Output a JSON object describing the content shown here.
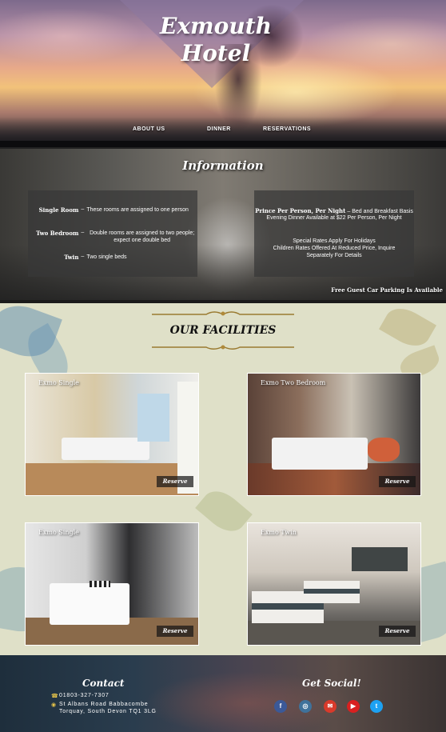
{
  "hero": {
    "title_line1": "Exmouth",
    "title_line2": "Hotel",
    "nav": [
      "ABOUT US",
      "DINNER",
      "RESERVATIONS"
    ]
  },
  "info": {
    "title": "Information",
    "rooms": [
      {
        "name": "Single Room",
        "sep": "–",
        "desc": "These rooms are assigned to one person"
      },
      {
        "name": "Two Bedroom",
        "sep": "–",
        "desc": "Double rooms are assigned to two people; expect one double bed"
      },
      {
        "name": "Twin",
        "sep": "–",
        "desc": "Two single beds"
      }
    ],
    "pricing_label": "Prince Per Person, Per Night",
    "pricing_sep": "–",
    "pricing_detail": "Bed and Breakfast Basis",
    "dinner": "Evening Dinner Available at $22 Per Person, Per Night",
    "special1": "Special Rates Apply For Holidays",
    "special2": "Children Rates Offered At Reduced Price, Inquire Separately For Details",
    "parking": "Free Guest Car Parking Is Available"
  },
  "facilities": {
    "title": "OUR FACILITIES",
    "cards": [
      {
        "label": "Exmo Single",
        "button": "Reserve"
      },
      {
        "label": "Exmo Two Bedroom",
        "button": "Reserve"
      },
      {
        "label": "Exmo Single",
        "button": "Reserve"
      },
      {
        "label": "Exmo Twin",
        "button": "Reserve"
      }
    ]
  },
  "footer": {
    "contact_title": "Contact",
    "phone": "01803-327-7307",
    "address_line1": "St Albans Road Babbacombe",
    "address_line2": "Torquay, South Devon TQ1 3LG",
    "social_title": "Get Social!",
    "social_icons": [
      "facebook-icon",
      "instagram-icon",
      "email-icon",
      "youtube-icon",
      "twitter-icon"
    ]
  },
  "colors": {
    "facilities_bg": "#dfe0c8",
    "facebook": "#3b5998",
    "instagram": "#3f729b",
    "email": "#d93a2b",
    "youtube": "#d92020",
    "twitter": "#1da1f2",
    "icon_gold": "#e8c54a"
  }
}
